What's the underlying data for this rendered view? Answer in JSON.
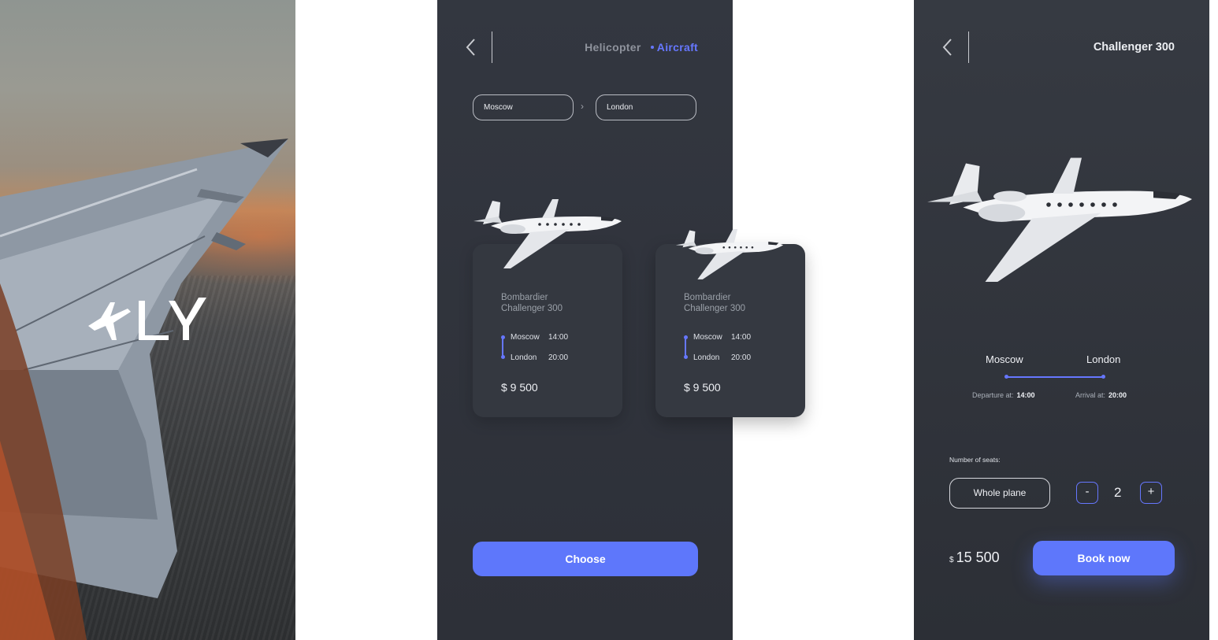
{
  "splash": {
    "logo_text": "FLY"
  },
  "listing": {
    "tabs": {
      "helicopter": "Helicopter",
      "aircraft": "Aircraft"
    },
    "from_city": "Moscow",
    "to_city": "London",
    "route_arrow": "›",
    "cards": [
      {
        "name_line1": "Bombardier",
        "name_line2": "Challenger 300",
        "leg1_city": "Moscow",
        "leg1_time": "14:00",
        "leg2_city": "London",
        "leg2_time": "20:00",
        "price": "$ 9 500"
      },
      {
        "name_line1": "Bombardier",
        "name_line2": "Challenger 300",
        "leg1_city": "Moscow",
        "leg1_time": "14:00",
        "leg2_city": "London",
        "leg2_time": "20:00",
        "price": "$ 9 500"
      }
    ],
    "choose_label": "Choose"
  },
  "detail": {
    "title": "Challenger 300",
    "from_city": "Moscow",
    "to_city": "London",
    "departure_label": "Departure at:",
    "departure_time": "14:00",
    "arrival_label": "Arrival at:",
    "arrival_time": "20:00",
    "seats_label": "Number of seats:",
    "whole_plane_label": "Whole plane",
    "minus_label": "-",
    "seat_count": "2",
    "plus_label": "+",
    "currency": "$",
    "total_price": "15 500",
    "book_label": "Book now"
  },
  "colors": {
    "accent": "#5e77fb",
    "background": "#30333b"
  }
}
